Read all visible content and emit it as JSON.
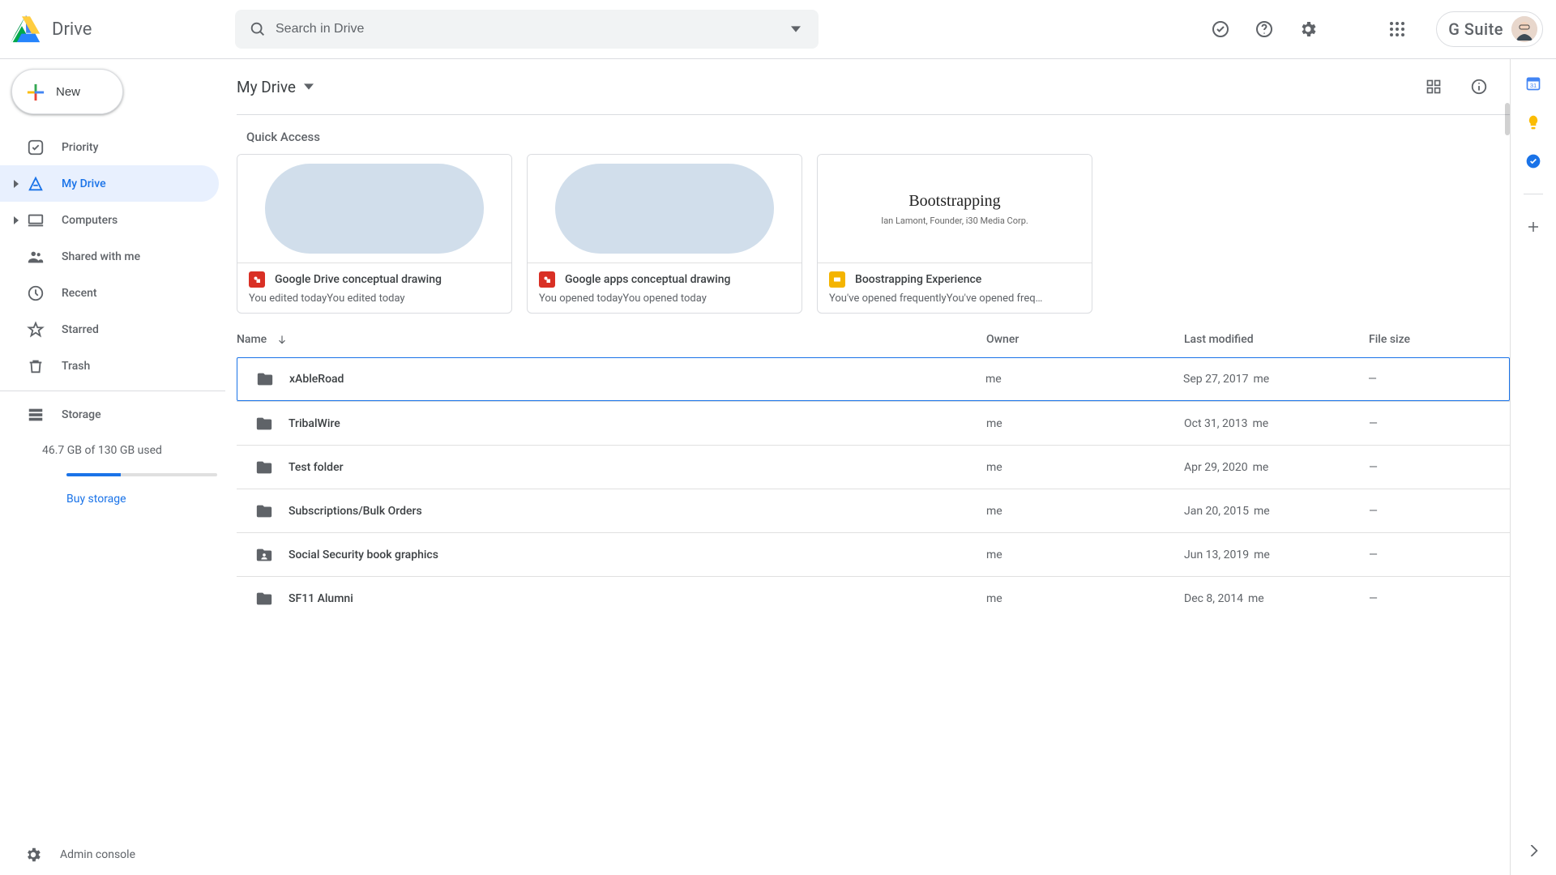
{
  "header": {
    "product": "Drive",
    "search_placeholder": "Search in Drive",
    "gsuite_label": "G Suite"
  },
  "sidebar": {
    "new_label": "New",
    "items": [
      {
        "label": "Priority"
      },
      {
        "label": "My Drive"
      },
      {
        "label": "Computers"
      },
      {
        "label": "Shared with me"
      },
      {
        "label": "Recent"
      },
      {
        "label": "Starred"
      },
      {
        "label": "Trash"
      }
    ],
    "storage_label": "Storage",
    "storage_text": "46.7 GB of 130 GB used",
    "buy_label": "Buy storage",
    "admin_label": "Admin console"
  },
  "main": {
    "path": "My Drive",
    "quick_access_title": "Quick Access",
    "quick": [
      {
        "title": "Google Drive conceptual drawing",
        "sub": "You edited todayYou edited today",
        "type": "drawing",
        "thumb_heading": "",
        "thumb_sub": ""
      },
      {
        "title": "Google apps conceptual drawing",
        "sub": "You opened todayYou opened today",
        "type": "drawing",
        "thumb_heading": "",
        "thumb_sub": ""
      },
      {
        "title": "Boostrapping Experience",
        "sub": "You've opened frequentlyYou've opened freq…",
        "type": "slides",
        "thumb_heading": "Bootstrapping",
        "thumb_sub": "Ian Lamont, Founder, i30 Media Corp."
      }
    ],
    "columns": {
      "name": "Name",
      "owner": "Owner",
      "modified": "Last modified",
      "size": "File size"
    },
    "rows": [
      {
        "name": "xAbleRoad",
        "owner": "me",
        "date": "Sep 27, 2017",
        "who": "me",
        "size": "—",
        "shared": false,
        "selected": true
      },
      {
        "name": "TribalWire",
        "owner": "me",
        "date": "Oct 31, 2013",
        "who": "me",
        "size": "—",
        "shared": false,
        "selected": false
      },
      {
        "name": "Test folder",
        "owner": "me",
        "date": "Apr 29, 2020",
        "who": "me",
        "size": "—",
        "shared": false,
        "selected": false
      },
      {
        "name": "Subscriptions/Bulk Orders",
        "owner": "me",
        "date": "Jan 20, 2015",
        "who": "me",
        "size": "—",
        "shared": false,
        "selected": false
      },
      {
        "name": "Social Security book graphics",
        "owner": "me",
        "date": "Jun 13, 2019",
        "who": "me",
        "size": "—",
        "shared": true,
        "selected": false
      },
      {
        "name": "SF11 Alumni",
        "owner": "me",
        "date": "Dec 8, 2014",
        "who": "me",
        "size": "—",
        "shared": false,
        "selected": false
      }
    ]
  }
}
